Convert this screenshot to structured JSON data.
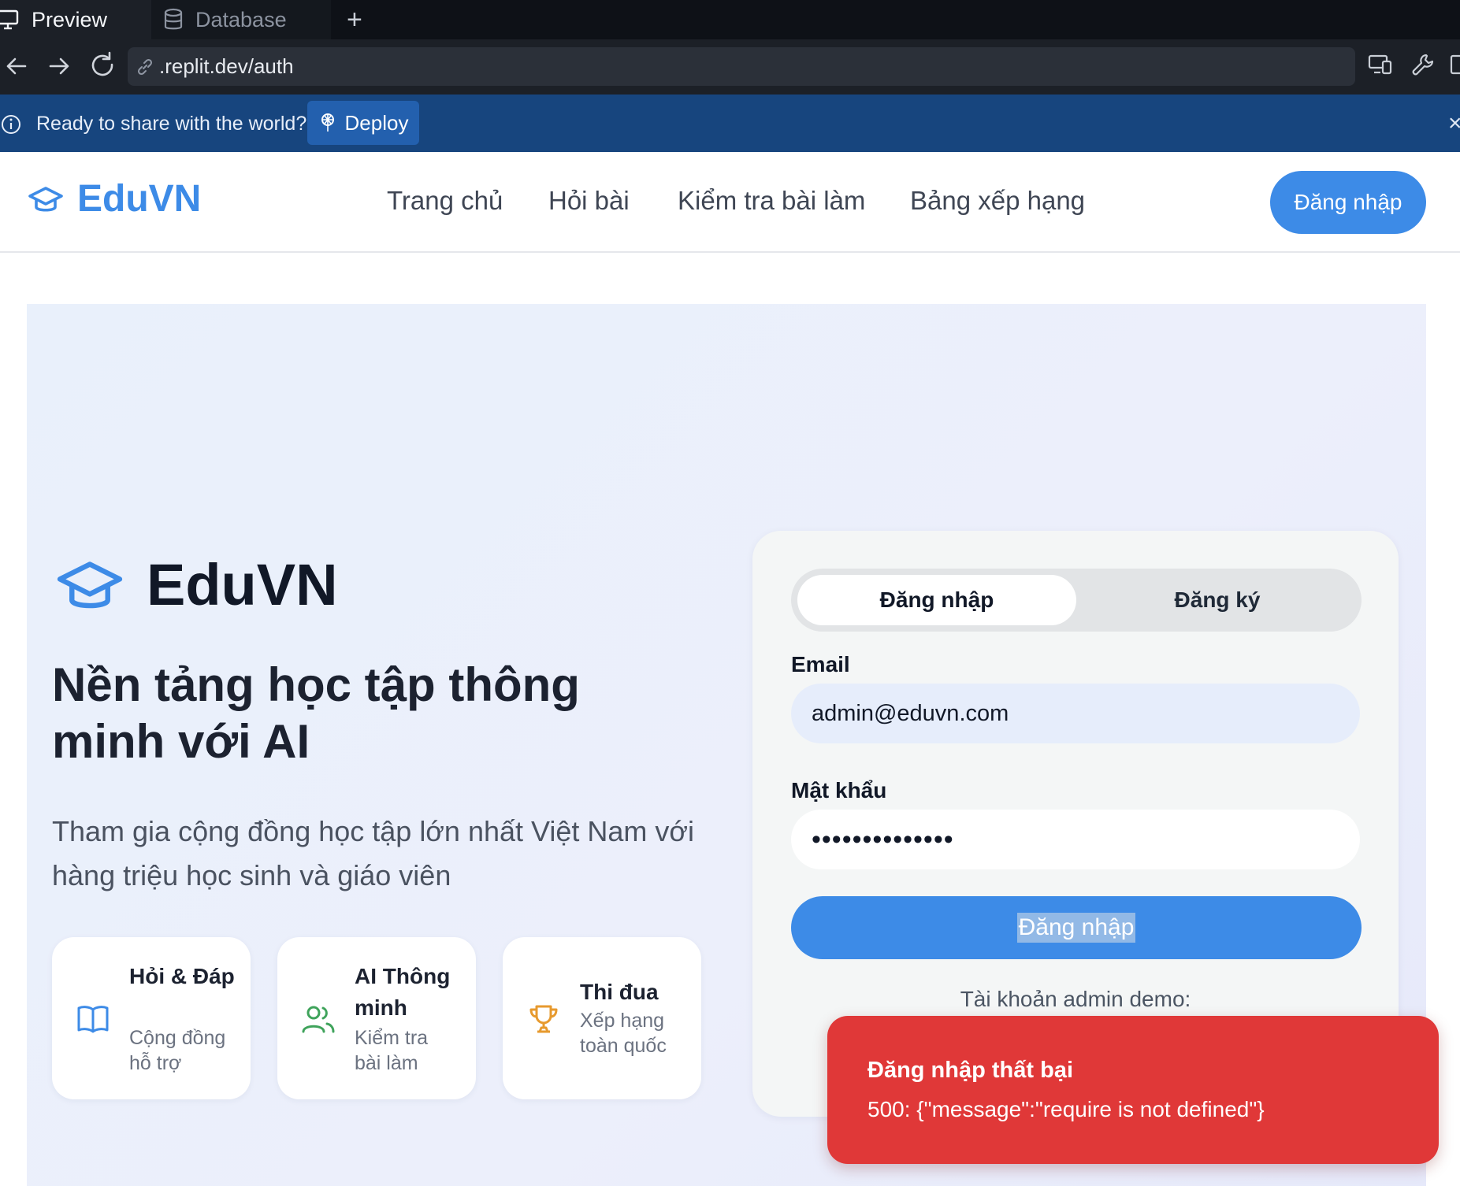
{
  "browser": {
    "tabs": [
      {
        "label": "Preview",
        "icon": "monitor-icon"
      },
      {
        "label": "Database",
        "icon": "database-icon"
      }
    ],
    "new_tab_label": "+",
    "url": ".replit.dev/auth",
    "deploy_banner": {
      "message": "Ready to share with the world?",
      "button_label": "Deploy",
      "close_label": "×"
    }
  },
  "header": {
    "brand": "EduVN",
    "nav": [
      "Trang chủ",
      "Hỏi bài",
      "Kiểm tra bài làm",
      "Bảng xếp hạng"
    ],
    "login_label": "Đăng nhập"
  },
  "hero": {
    "brand": "EduVN",
    "title": "Nền tảng học tập thông minh với AI",
    "subtitle": "Tham gia cộng đồng học tập lớn nhất Việt Nam với hàng triệu học sinh và giáo viên",
    "features": [
      {
        "title": "Hỏi & Đáp",
        "desc": "Cộng đồng hỗ trợ",
        "icon": "book-open-icon",
        "color": "#3d8be7"
      },
      {
        "title": "AI Thông minh",
        "desc": "Kiểm tra bài làm",
        "icon": "users-icon",
        "color": "#3fa35b"
      },
      {
        "title": "Thi đua",
        "desc": "Xếp hạng toàn quốc",
        "icon": "trophy-icon",
        "color": "#e79a2e"
      }
    ]
  },
  "auth": {
    "tabs": {
      "login": "Đăng nhập",
      "register": "Đăng ký"
    },
    "email_label": "Email",
    "email_value": "admin@eduvn.com",
    "password_label": "Mật khẩu",
    "password_value": "••••••••••••••",
    "submit_label": "Đăng nhập",
    "demo_label": "Tài khoản admin demo:"
  },
  "toast": {
    "title": "Đăng nhập thất bại",
    "message": "500: {\"message\":\"require is not defined\"}"
  },
  "colors": {
    "brand": "#3d8be7",
    "deploy_bar": "#17457e",
    "toast": "#e03838"
  }
}
